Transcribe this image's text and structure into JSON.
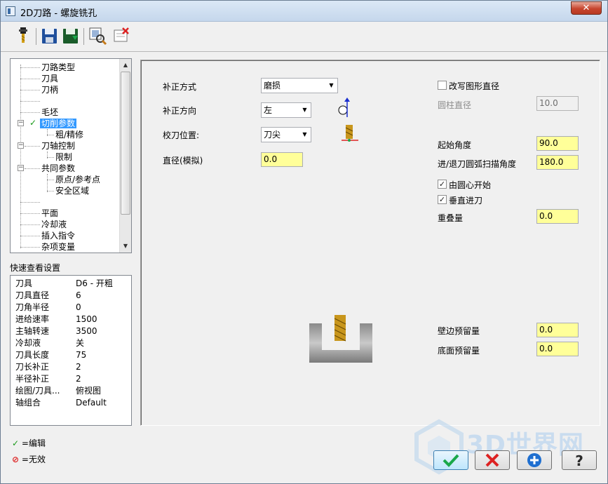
{
  "window": {
    "title": "2D刀路 - 螺旋铣孔",
    "close_label": "✕"
  },
  "toolbar": {
    "buttons": [
      "tool-icon",
      "save-icon",
      "save-as-icon",
      "view-icon",
      "delete-icon"
    ]
  },
  "tree": {
    "items": [
      {
        "label": "刀路类型"
      },
      {
        "label": "刀具"
      },
      {
        "label": "刀柄"
      },
      {
        "label": ""
      },
      {
        "label": "毛坯"
      },
      {
        "label": "切削参数"
      },
      {
        "label": "粗/精修"
      },
      {
        "label": "刀轴控制"
      },
      {
        "label": "限制"
      },
      {
        "label": "共同参数"
      },
      {
        "label": "原点/参考点"
      },
      {
        "label": "安全区域"
      },
      {
        "label": ""
      },
      {
        "label": "平面"
      },
      {
        "label": "冷却液"
      },
      {
        "label": "插入指令"
      },
      {
        "label": "杂项变量"
      }
    ]
  },
  "quick": {
    "title": "快速查看设置",
    "rows": [
      {
        "k": "刀具",
        "v": "D6 - 开粗"
      },
      {
        "k": "刀具直径",
        "v": "6"
      },
      {
        "k": "刀角半径",
        "v": "0"
      },
      {
        "k": "进给速率",
        "v": "1500"
      },
      {
        "k": "主轴转速",
        "v": "3500"
      },
      {
        "k": "冷却液",
        "v": "关"
      },
      {
        "k": "刀具长度",
        "v": "75"
      },
      {
        "k": "刀长补正",
        "v": "2"
      },
      {
        "k": "半径补正",
        "v": "2"
      },
      {
        "k": "绘图/刀具...",
        "v": "俯视图"
      },
      {
        "k": "轴组合",
        "v": "Default"
      }
    ]
  },
  "legend": {
    "edit": "=编辑",
    "invalid": "=无效"
  },
  "form": {
    "comp_type_label": "补正方式",
    "comp_type_value": "磨损",
    "comp_dir_label": "补正方向",
    "comp_dir_value": "左",
    "tip_label": "校刀位置:",
    "tip_value": "刀尖",
    "diameter_label": "直径(模拟)",
    "diameter_value": "0.0",
    "override_label": "改写图形直径",
    "cyl_diam_label": "圆柱直径",
    "cyl_diam_value": "10.0",
    "start_angle_label": "起始角度",
    "start_angle_value": "90.0",
    "sweep_label": "进/退刀圆弧扫描角度",
    "sweep_value": "180.0",
    "from_center_label": "由圆心开始",
    "vertical_entry_label": "垂直进刀",
    "overlap_label": "重叠量",
    "overlap_value": "0.0",
    "wall_stock_label": "壁边预留量",
    "wall_stock_value": "0.0",
    "floor_stock_label": "底面预留量",
    "floor_stock_value": "0.0"
  },
  "colors": {
    "selected": "#3399ff",
    "field_yellow": "#ffff99"
  },
  "watermark": "3D世界网"
}
